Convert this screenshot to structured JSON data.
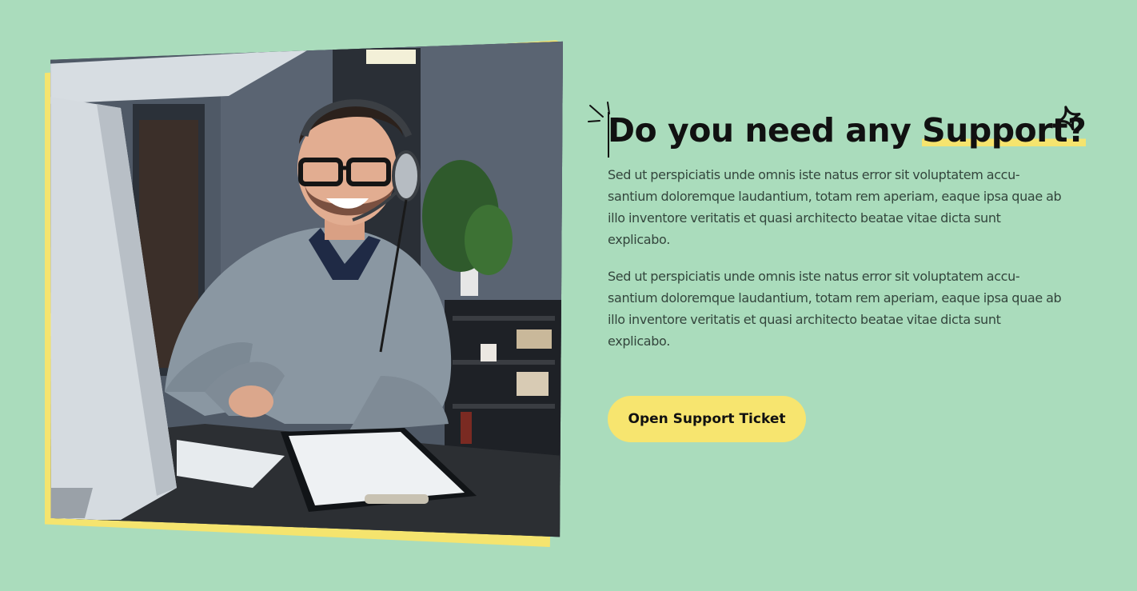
{
  "hero": {
    "image_alt": "Smiling support agent wearing a headset working at a computer",
    "heading_prefix": "Do you need any ",
    "heading_highlight": "Support?",
    "paragraphs": [
      "Sed ut perspiciatis unde omnis iste natus error sit voluptatem accu-santium doloremque laudantium, totam rem aperiam, eaque ipsa quae ab illo inventore veritatis et quasi architecto beatae vitae dicta sunt explicabo.",
      "Sed ut perspiciatis unde omnis iste natus error sit voluptatem accu-santium doloremque laudantium, totam rem aperiam, eaque ipsa quae ab illo inventore veritatis et quasi architecto beatae vitae dicta sunt explicabo."
    ],
    "cta_label": "Open Support Ticket"
  },
  "theme": {
    "background": "#aadcbc",
    "accent": "#f5e46e",
    "text": "#111111",
    "body_text": "#33453c"
  },
  "icons": {
    "heading_left": "spark-lines-icon",
    "heading_right": "sparkle-star-icon"
  }
}
